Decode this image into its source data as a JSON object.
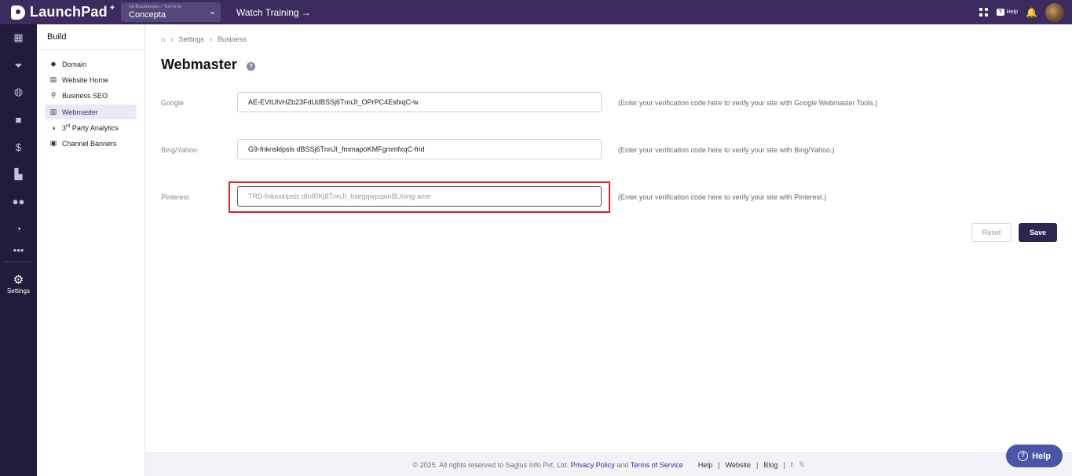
{
  "topbar": {
    "app_name": "LaunchPad",
    "business_small": "All Businesses › You're in",
    "business_name": "Concepta",
    "watch_training": "Watch Training →",
    "help_label": "Help"
  },
  "rail": {
    "settings_label": "Settings"
  },
  "sidebar": {
    "title": "Build",
    "items": [
      {
        "label": "Domain",
        "icon": "domain-icon"
      },
      {
        "label": "Website Home",
        "icon": "website-home-icon"
      },
      {
        "label": "Business SEO",
        "icon": "seo-icon"
      },
      {
        "label": "Webmaster",
        "icon": "webmaster-icon"
      },
      {
        "label_sup": "rd",
        "label_prefix": "3",
        "label_suffix": " Party Analytics",
        "icon": "analytics-icon"
      },
      {
        "label": "Channel Banners",
        "icon": "banners-icon"
      }
    ]
  },
  "breadcrumb": {
    "items": [
      "Settings",
      "Business"
    ]
  },
  "page": {
    "title": "Webmaster"
  },
  "form": {
    "google": {
      "label": "Google",
      "value": "AE-EVtUfvHZb23FdUdBSSj6TnnJI_OPrPC4EsfxqC-w",
      "hint": "(Enter your verification code here to verify your site with Google Webmaster Tools.)"
    },
    "bing": {
      "label": "Bing/Yahoo",
      "value": "G9-fnknsklpsls dBSSj6TnnJI_fmmapoKMFgmmfxqC-fnd",
      "hint": "(Enter your verification code here to verify your site with Bing/Yahoo.)"
    },
    "pinterest": {
      "label": "Pinterest",
      "placeholder": "TRD-fnknsklpsls dfnIRKj8TnnJI_fniegqwpqwnBUning-ame",
      "hint": "(Enter your verification code here to verify your site with Pinterest.)"
    },
    "reset_label": "Reset",
    "save_label": "Save"
  },
  "footer": {
    "copyright": "©  2025. All rights reserved to Saglus Info Pvt. Ltd.",
    "privacy": "Privacy Policy",
    "and": "and",
    "terms": "Terms of Service",
    "help": "Help",
    "website": "Website",
    "blog": "Blog"
  },
  "help_fab": {
    "label": "Help"
  },
  "colors": {
    "topbar": "#3b2b5f",
    "rail": "#231b3b",
    "save": "#2e2450",
    "highlight": "#e02020",
    "help_fab": "#4a55a8"
  }
}
